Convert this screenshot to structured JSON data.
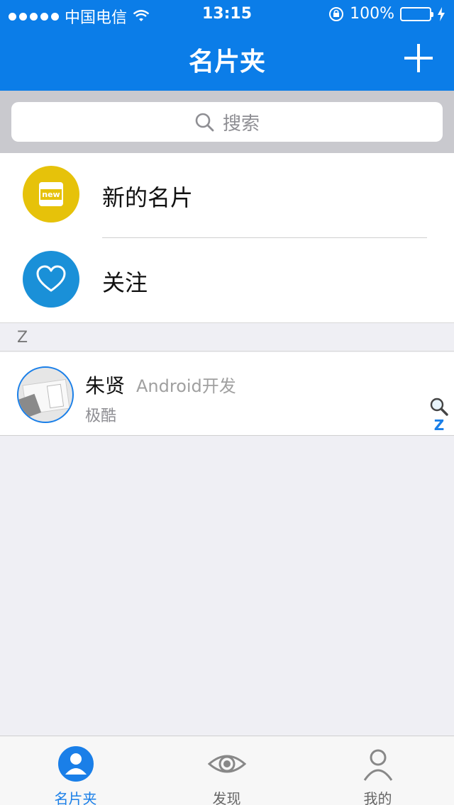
{
  "status_bar": {
    "carrier": "中国电信",
    "time": "13:15",
    "battery": "100%",
    "battery_level": 1.0
  },
  "nav": {
    "title": "名片夹",
    "add_icon": "plus-icon"
  },
  "search": {
    "placeholder": "搜索",
    "icon": "search-icon"
  },
  "menu": {
    "items": [
      {
        "label": "新的名片",
        "icon": "new-card-icon",
        "icon_text": "new",
        "color": "#e6c20a"
      },
      {
        "label": "关注",
        "icon": "heart-icon",
        "color": "#1a90d8"
      }
    ]
  },
  "contacts": {
    "sections": [
      {
        "header": "Z",
        "items": [
          {
            "name": "朱贤",
            "title": "Android开发",
            "company": "极酷",
            "avatar": "avatar-photo"
          }
        ]
      }
    ]
  },
  "index_bar": {
    "search_icon": "search-icon",
    "letters": [
      "Z"
    ]
  },
  "tabbar": {
    "tabs": [
      {
        "label": "名片夹",
        "icon": "person-icon",
        "active": true
      },
      {
        "label": "发现",
        "icon": "eye-icon",
        "active": false
      },
      {
        "label": "我的",
        "icon": "profile-icon",
        "active": false
      }
    ]
  },
  "colors": {
    "primary": "#0b7de8",
    "accent": "#1a7fe8",
    "background": "#efeff4"
  }
}
